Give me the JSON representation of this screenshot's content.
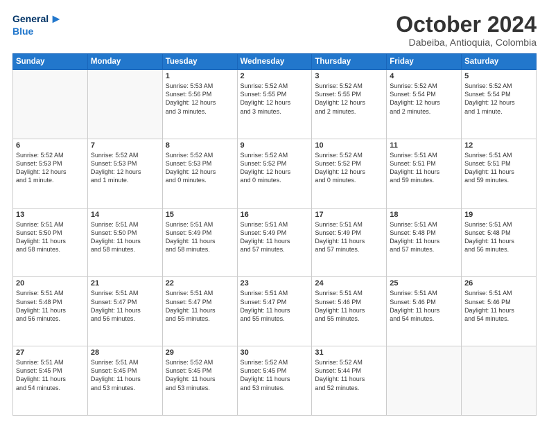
{
  "header": {
    "logo_general": "General",
    "logo_blue": "Blue",
    "month": "October 2024",
    "location": "Dabeiba, Antioquia, Colombia"
  },
  "days_of_week": [
    "Sunday",
    "Monday",
    "Tuesday",
    "Wednesday",
    "Thursday",
    "Friday",
    "Saturday"
  ],
  "weeks": [
    [
      {
        "day": "",
        "info": ""
      },
      {
        "day": "",
        "info": ""
      },
      {
        "day": "1",
        "info": "Sunrise: 5:53 AM\nSunset: 5:56 PM\nDaylight: 12 hours\nand 3 minutes."
      },
      {
        "day": "2",
        "info": "Sunrise: 5:52 AM\nSunset: 5:55 PM\nDaylight: 12 hours\nand 3 minutes."
      },
      {
        "day": "3",
        "info": "Sunrise: 5:52 AM\nSunset: 5:55 PM\nDaylight: 12 hours\nand 2 minutes."
      },
      {
        "day": "4",
        "info": "Sunrise: 5:52 AM\nSunset: 5:54 PM\nDaylight: 12 hours\nand 2 minutes."
      },
      {
        "day": "5",
        "info": "Sunrise: 5:52 AM\nSunset: 5:54 PM\nDaylight: 12 hours\nand 1 minute."
      }
    ],
    [
      {
        "day": "6",
        "info": "Sunrise: 5:52 AM\nSunset: 5:53 PM\nDaylight: 12 hours\nand 1 minute."
      },
      {
        "day": "7",
        "info": "Sunrise: 5:52 AM\nSunset: 5:53 PM\nDaylight: 12 hours\nand 1 minute."
      },
      {
        "day": "8",
        "info": "Sunrise: 5:52 AM\nSunset: 5:53 PM\nDaylight: 12 hours\nand 0 minutes."
      },
      {
        "day": "9",
        "info": "Sunrise: 5:52 AM\nSunset: 5:52 PM\nDaylight: 12 hours\nand 0 minutes."
      },
      {
        "day": "10",
        "info": "Sunrise: 5:52 AM\nSunset: 5:52 PM\nDaylight: 12 hours\nand 0 minutes."
      },
      {
        "day": "11",
        "info": "Sunrise: 5:51 AM\nSunset: 5:51 PM\nDaylight: 11 hours\nand 59 minutes."
      },
      {
        "day": "12",
        "info": "Sunrise: 5:51 AM\nSunset: 5:51 PM\nDaylight: 11 hours\nand 59 minutes."
      }
    ],
    [
      {
        "day": "13",
        "info": "Sunrise: 5:51 AM\nSunset: 5:50 PM\nDaylight: 11 hours\nand 58 minutes."
      },
      {
        "day": "14",
        "info": "Sunrise: 5:51 AM\nSunset: 5:50 PM\nDaylight: 11 hours\nand 58 minutes."
      },
      {
        "day": "15",
        "info": "Sunrise: 5:51 AM\nSunset: 5:49 PM\nDaylight: 11 hours\nand 58 minutes."
      },
      {
        "day": "16",
        "info": "Sunrise: 5:51 AM\nSunset: 5:49 PM\nDaylight: 11 hours\nand 57 minutes."
      },
      {
        "day": "17",
        "info": "Sunrise: 5:51 AM\nSunset: 5:49 PM\nDaylight: 11 hours\nand 57 minutes."
      },
      {
        "day": "18",
        "info": "Sunrise: 5:51 AM\nSunset: 5:48 PM\nDaylight: 11 hours\nand 57 minutes."
      },
      {
        "day": "19",
        "info": "Sunrise: 5:51 AM\nSunset: 5:48 PM\nDaylight: 11 hours\nand 56 minutes."
      }
    ],
    [
      {
        "day": "20",
        "info": "Sunrise: 5:51 AM\nSunset: 5:48 PM\nDaylight: 11 hours\nand 56 minutes."
      },
      {
        "day": "21",
        "info": "Sunrise: 5:51 AM\nSunset: 5:47 PM\nDaylight: 11 hours\nand 56 minutes."
      },
      {
        "day": "22",
        "info": "Sunrise: 5:51 AM\nSunset: 5:47 PM\nDaylight: 11 hours\nand 55 minutes."
      },
      {
        "day": "23",
        "info": "Sunrise: 5:51 AM\nSunset: 5:47 PM\nDaylight: 11 hours\nand 55 minutes."
      },
      {
        "day": "24",
        "info": "Sunrise: 5:51 AM\nSunset: 5:46 PM\nDaylight: 11 hours\nand 55 minutes."
      },
      {
        "day": "25",
        "info": "Sunrise: 5:51 AM\nSunset: 5:46 PM\nDaylight: 11 hours\nand 54 minutes."
      },
      {
        "day": "26",
        "info": "Sunrise: 5:51 AM\nSunset: 5:46 PM\nDaylight: 11 hours\nand 54 minutes."
      }
    ],
    [
      {
        "day": "27",
        "info": "Sunrise: 5:51 AM\nSunset: 5:45 PM\nDaylight: 11 hours\nand 54 minutes."
      },
      {
        "day": "28",
        "info": "Sunrise: 5:51 AM\nSunset: 5:45 PM\nDaylight: 11 hours\nand 53 minutes."
      },
      {
        "day": "29",
        "info": "Sunrise: 5:52 AM\nSunset: 5:45 PM\nDaylight: 11 hours\nand 53 minutes."
      },
      {
        "day": "30",
        "info": "Sunrise: 5:52 AM\nSunset: 5:45 PM\nDaylight: 11 hours\nand 53 minutes."
      },
      {
        "day": "31",
        "info": "Sunrise: 5:52 AM\nSunset: 5:44 PM\nDaylight: 11 hours\nand 52 minutes."
      },
      {
        "day": "",
        "info": ""
      },
      {
        "day": "",
        "info": ""
      }
    ]
  ]
}
